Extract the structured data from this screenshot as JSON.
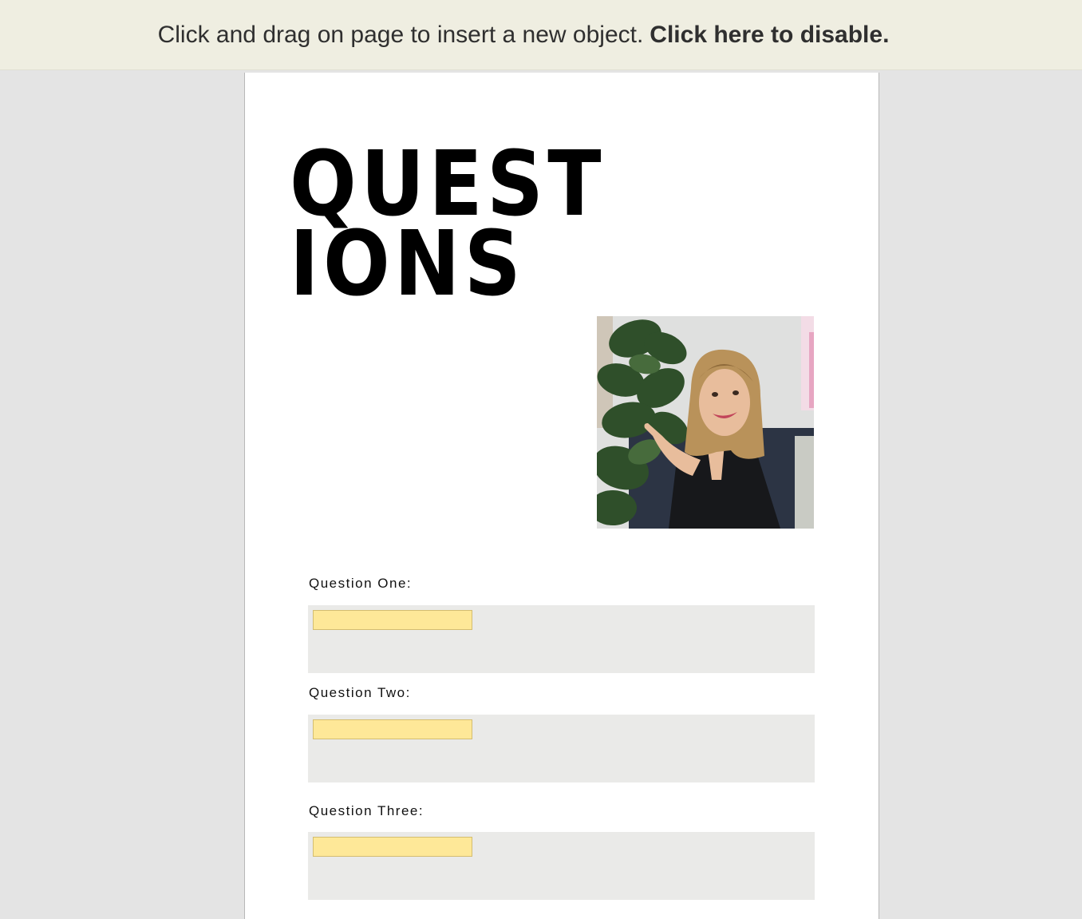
{
  "banner": {
    "message": "Click and drag on page to insert a new object.",
    "disable_label": "Click here to disable."
  },
  "document": {
    "title": "QUEST\nIONS",
    "photo": {
      "icon": "person-pointing-photo",
      "colors": {
        "wall": "#dfe0df",
        "plant": "#2f4f2a",
        "sofa": "#2c3444",
        "top": "#17181b",
        "hair": "#b9925a",
        "skin": "#e8bd9c"
      }
    },
    "questions": [
      {
        "label": "Question One:"
      },
      {
        "label": "Question Two:"
      },
      {
        "label": "Question Three:"
      }
    ]
  },
  "colors": {
    "banner_bg": "#efeee1",
    "workspace_bg": "#e4e4e4",
    "answer_box_bg": "#eaeae8",
    "field_fill": "#fee898",
    "field_border": "#d4bd70"
  }
}
